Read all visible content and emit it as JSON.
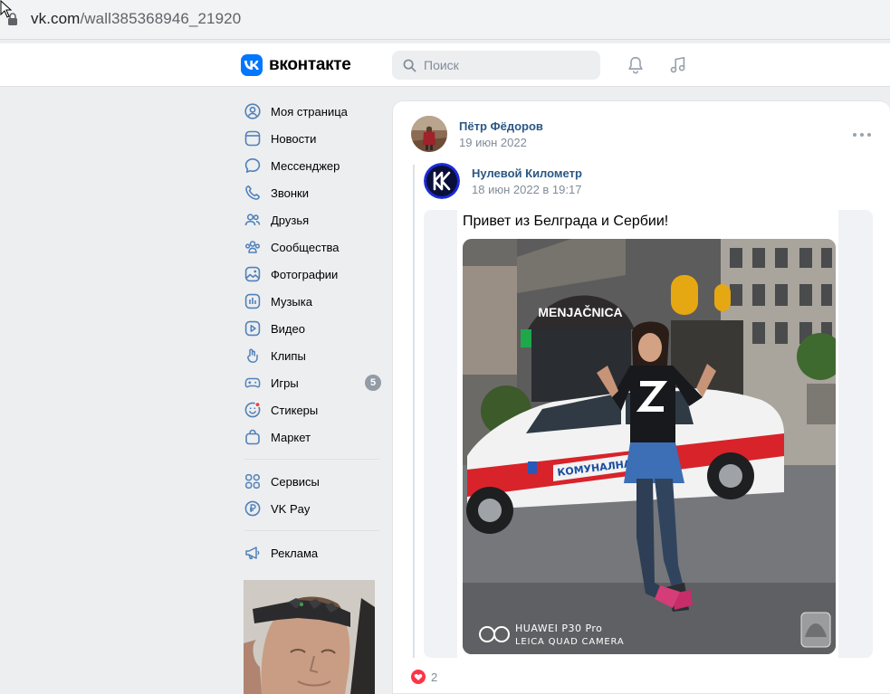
{
  "browser": {
    "url_domain": "vk.com",
    "url_path": "/wall385368946_21920"
  },
  "header": {
    "logo_text": "вконтакте",
    "search_placeholder": "Поиск",
    "icons": [
      "bell-icon",
      "music-icon"
    ]
  },
  "nav": {
    "items": [
      {
        "label": "Моя страница",
        "icon": "profile-icon"
      },
      {
        "label": "Новости",
        "icon": "news-icon"
      },
      {
        "label": "Мессенджер",
        "icon": "messenger-icon"
      },
      {
        "label": "Звонки",
        "icon": "phone-icon"
      },
      {
        "label": "Друзья",
        "icon": "friends-icon"
      },
      {
        "label": "Сообщества",
        "icon": "communities-icon"
      },
      {
        "label": "Фотографии",
        "icon": "photos-icon"
      },
      {
        "label": "Музыка",
        "icon": "music-icon"
      },
      {
        "label": "Видео",
        "icon": "video-icon"
      },
      {
        "label": "Клипы",
        "icon": "clips-icon"
      },
      {
        "label": "Игры",
        "icon": "games-icon",
        "badge": "5"
      },
      {
        "label": "Стикеры",
        "icon": "stickers-icon"
      },
      {
        "label": "Маркет",
        "icon": "market-icon"
      }
    ],
    "secondary": [
      {
        "label": "Сервисы",
        "icon": "services-icon"
      },
      {
        "label": "VK Pay",
        "icon": "vkpay-icon"
      }
    ],
    "ads": {
      "label": "Реклама",
      "icon": "megaphone-icon"
    }
  },
  "post": {
    "author": "Пётр Фёдоров",
    "date": "19 июн 2022",
    "repost": {
      "author": "Нулевой Километр",
      "date": "18 июн 2022 в 19:17",
      "text": "Привет из Белграда и Сербии!"
    },
    "photo": {
      "watermark_line1": "HUAWEI P30 Pro",
      "watermark_line2": "LEICA QUAD CAMERA",
      "sign_text": "MENJAČNICA",
      "car_text": "КОМУНАЛНА"
    },
    "likes": "2"
  },
  "colors": {
    "accent": "#0077ff",
    "link": "#2a5885",
    "muted": "#818c99",
    "background": "#edeef0"
  }
}
